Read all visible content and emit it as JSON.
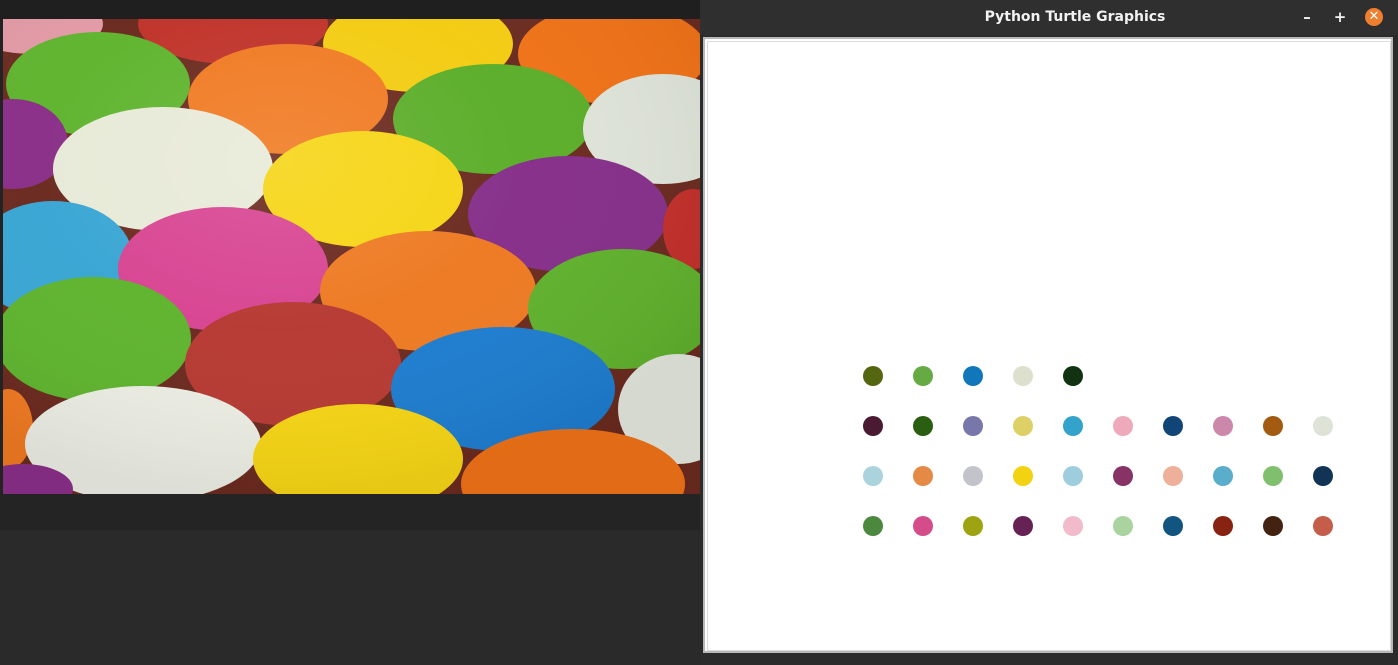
{
  "turtle_window": {
    "title": "Python Turtle Graphics",
    "minimize_label": "–",
    "maximize_label": "+",
    "close_label": "✕"
  },
  "icons": {
    "minimize": "minimize-icon",
    "maximize": "maximize-icon",
    "close": "close-icon"
  },
  "colors": {
    "close_button": "#f07e2f",
    "canvas_background": "#ffffff"
  },
  "dot_rows": [
    [
      "#556611",
      "#66aa44",
      "#1177bb",
      "#dde0cc",
      "#113311"
    ],
    [
      "#4a1a33",
      "#2a5e11",
      "#7777aa",
      "#ddd066",
      "#33a3cc",
      "#eeaabb",
      "#114477",
      "#cc88aa",
      "#a35a11",
      "#dde3d6"
    ],
    [
      "#aad3dd",
      "#e48a44",
      "#c3c3cc",
      "#f2d211",
      "#9ecedd",
      "#883366",
      "#eeb09a",
      "#5aaecc",
      "#7fbf6d",
      "#113355"
    ],
    [
      "#4d883f",
      "#d44d8a",
      "#9ea311",
      "#662255",
      "#f2bbcc",
      "#aad3a0",
      "#115580",
      "#882211",
      "#442211",
      "#c45e4a"
    ]
  ]
}
